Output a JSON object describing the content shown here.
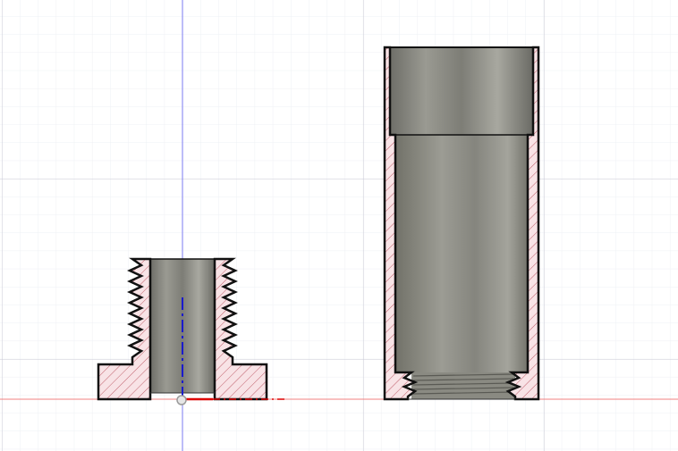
{
  "colors": {
    "background": "#ffffff",
    "grid_major": "#c9c9d6",
    "grid_minor": "#eef0f4",
    "axis_vertical": "#7b7bf2",
    "axis_horizontal": "#f08080",
    "section_hatch_fill": "#f8e3e6",
    "section_hatch_line": "#c0606c",
    "outline": "#111111",
    "bore_shade_dark": "#6e6e68",
    "bore_shade_light": "#a8a8a0",
    "sketch_blue": "#1a1acc",
    "sketch_red": "#dd0000",
    "origin_point": "#bfbfbf"
  },
  "parts": [
    {
      "name": "threaded-insert",
      "view": "section"
    },
    {
      "name": "threaded-sleeve",
      "view": "section"
    }
  ]
}
